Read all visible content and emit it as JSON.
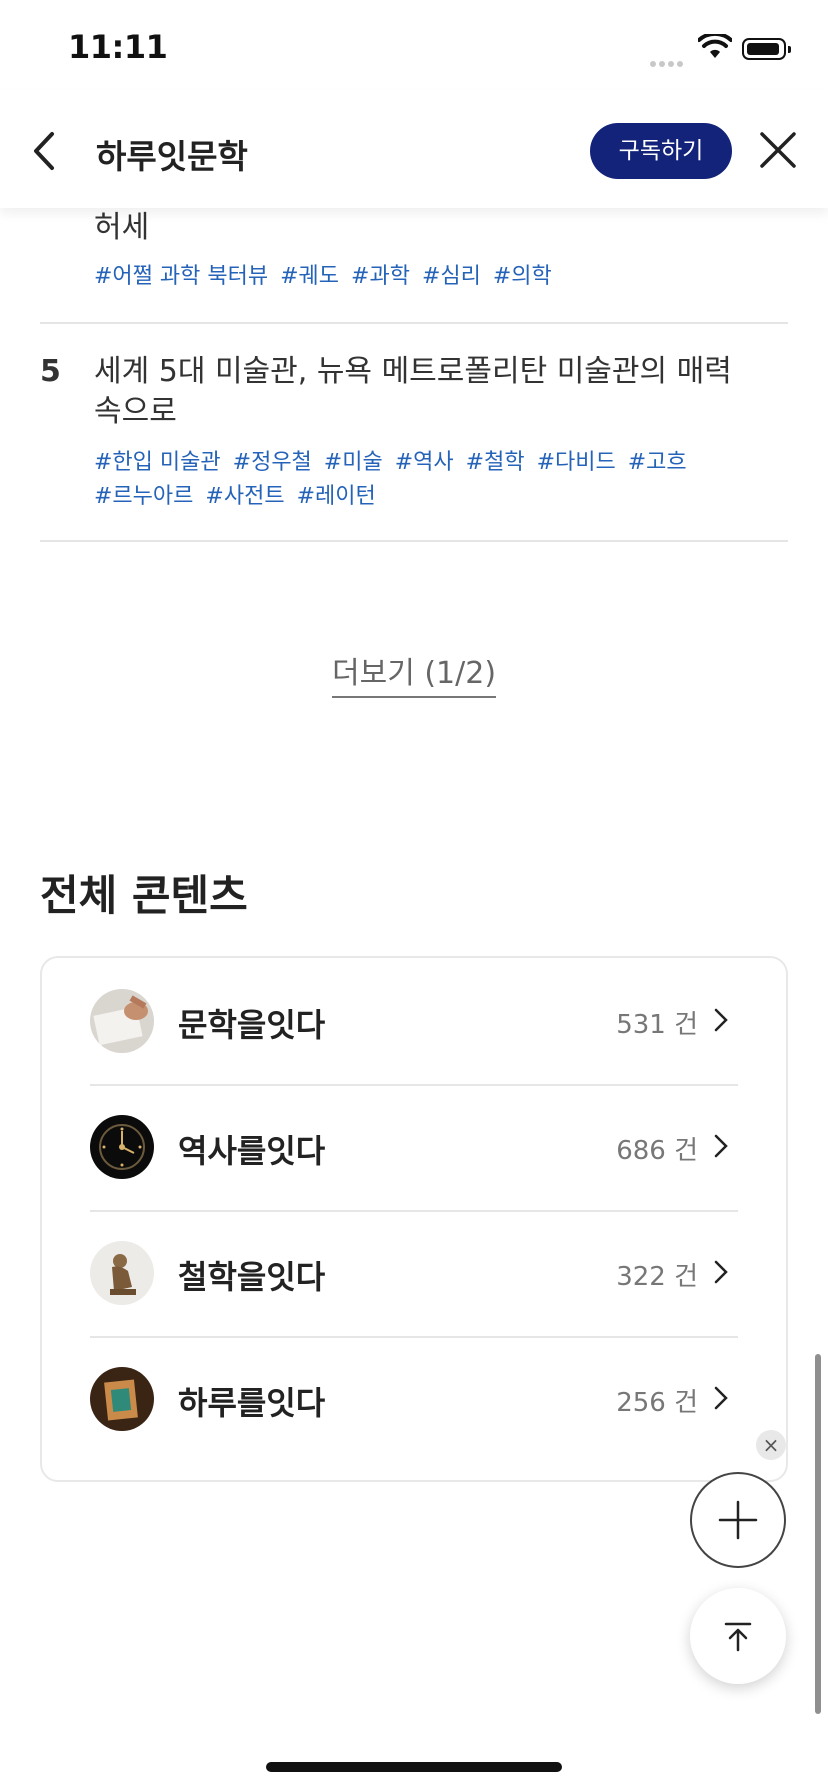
{
  "status_bar": {
    "time": "11:11"
  },
  "header": {
    "title": "하루잇문학",
    "subscribe_label": "구독하기"
  },
  "articles": [
    {
      "rank": "",
      "title": "허세",
      "tags": [
        "#어쩔 과학 북터뷰",
        "#궤도",
        "#과학",
        "#심리",
        "#의학"
      ]
    },
    {
      "rank": "5",
      "title": "세계 5대 미술관, 뉴욕 메트로폴리탄 미술관의 매력 속으로",
      "tags": [
        "#한입 미술관",
        "#정우철",
        "#미술",
        "#역사",
        "#철학",
        "#다비드",
        "#고흐",
        "#르누아르",
        "#사전트",
        "#레이턴"
      ]
    }
  ],
  "more_button": "더보기 (1/2)",
  "all_contents": {
    "title": "전체 콘텐츠",
    "items": [
      {
        "label": "문학을잇다",
        "count": "531 건",
        "icon": "literature-thumb"
      },
      {
        "label": "역사를잇다",
        "count": "686 건",
        "icon": "history-thumb"
      },
      {
        "label": "철학을잇다",
        "count": "322 건",
        "icon": "philosophy-thumb"
      },
      {
        "label": "하루를잇다",
        "count": "256 건",
        "icon": "daily-thumb"
      }
    ]
  },
  "colors": {
    "accent": "#13237a",
    "tag": "#2563b8"
  }
}
